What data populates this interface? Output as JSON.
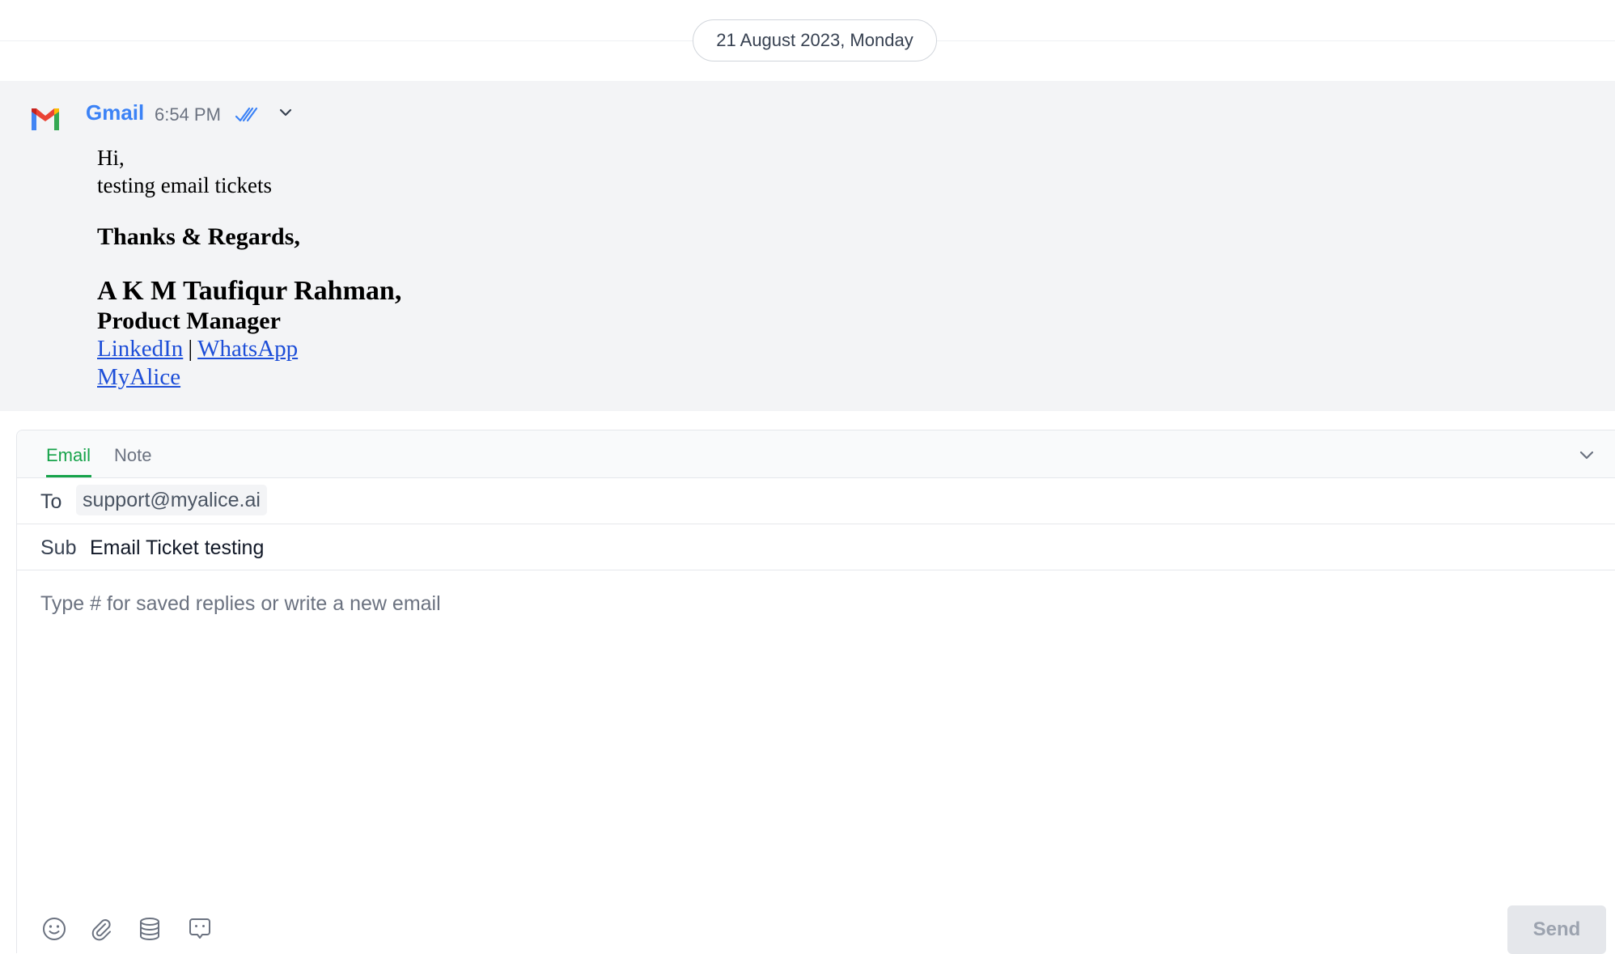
{
  "date_separator": "21 August 2023, Monday",
  "message": {
    "sender": "Gmail",
    "time": "6:54 PM",
    "status_icon": "double-check-icon",
    "body": {
      "greeting": "Hi,",
      "text": "testing email tickets",
      "closing": "Thanks & Regards,",
      "signature_name": "A K M Taufiqur Rahman,",
      "signature_role": "Product Manager",
      "links": [
        "LinkedIn",
        "WhatsApp",
        "MyAlice"
      ],
      "separator": "|"
    }
  },
  "composer": {
    "tabs": [
      "Email",
      "Note"
    ],
    "active_tab": "Email",
    "to_label": "To",
    "to_value": "support@myalice.ai",
    "sub_label": "Sub",
    "sub_value": "Email Ticket testing",
    "editor_placeholder": "Type # for saved replies or write a new email",
    "toolbar_icons": [
      "emoji-icon",
      "attachment-icon",
      "database-icon",
      "saved-reply-icon"
    ],
    "send_label": "Send"
  },
  "colors": {
    "accent_green": "#16a34a",
    "gmail_blue": "#3b82f6",
    "message_bg": "#f3f4f6",
    "link_blue": "#1d4ed8"
  }
}
